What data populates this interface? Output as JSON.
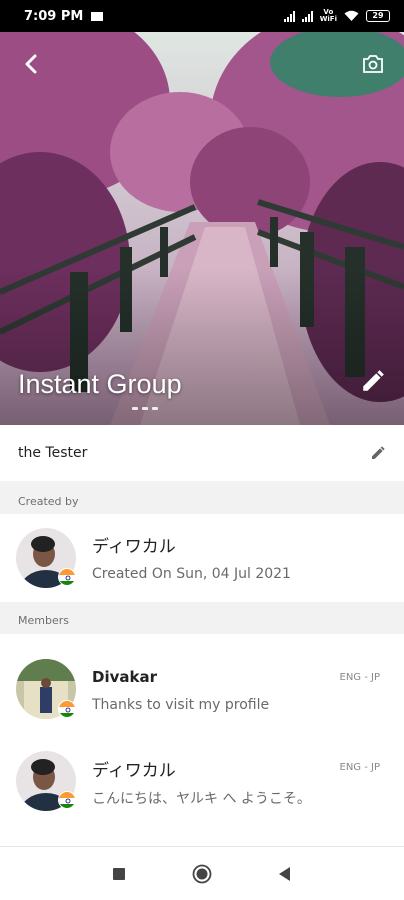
{
  "status_bar": {
    "time": "7:09 PM",
    "battery": "29",
    "volte_top": "Vo",
    "volte_bottom": "WiFi"
  },
  "group": {
    "name": "Instant Group",
    "description": "the Tester"
  },
  "created_by": {
    "label": "Created by",
    "name": "ディワカル",
    "created_on": "Created On Sun, 04 Jul 2021"
  },
  "members": {
    "label": "Members",
    "items": [
      {
        "name": "Divakar",
        "status": "Thanks to visit my profile",
        "language": "ENG - JP"
      },
      {
        "name": "ディワカル",
        "status": "こんにちは、ヤルキ へ ようこそ。",
        "language": "ENG - JP"
      }
    ]
  },
  "icons": {
    "back": "arrow-back-icon",
    "camera": "camera-icon",
    "edit": "pencil-icon",
    "flag": "india-flag-icon",
    "nav": [
      "square-recents-icon",
      "circle-home-icon",
      "triangle-back-icon"
    ]
  },
  "colors": {
    "accent": "#ffffff",
    "section_bg": "#f2f2f2",
    "card_bg": "#ffffff",
    "status_bar": "#000000"
  }
}
